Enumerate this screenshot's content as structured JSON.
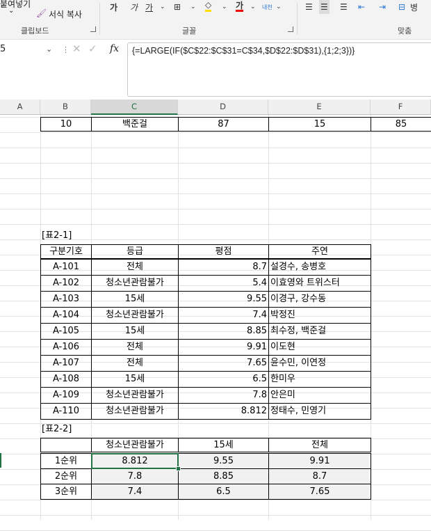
{
  "ribbon": {
    "paste_label": "붙여넣기",
    "format_painter_label": "서식 복사",
    "clipboard_group": "클립보드",
    "font_group": "글꼴",
    "align_group": "맞춤",
    "italic_label": "가",
    "underline_label": "가",
    "bold_label": "가",
    "font_color_label": "가",
    "phonetic_label": "내천",
    "merge_label": "병"
  },
  "formula_bar": {
    "name_box": "5",
    "fx_label": "fx",
    "formula": "{=LARGE(IF($C$22:$C$31=C$34,$D$22:$D$31),{1;2;3})}"
  },
  "columns": [
    "A",
    "B",
    "C",
    "D",
    "E",
    "F"
  ],
  "selected_column": "C",
  "top_row": {
    "b": "10",
    "c": "백준걸",
    "d": "87",
    "e": "15",
    "f": "85"
  },
  "table1": {
    "caption": "[표2-1]",
    "headers": [
      "구분기호",
      "등급",
      "평점",
      "주연"
    ],
    "rows": [
      [
        "A-101",
        "전체",
        "8.7",
        "설경수, 송병호"
      ],
      [
        "A-102",
        "청소년관람불가",
        "5.4",
        "이효영와 트위스터"
      ],
      [
        "A-103",
        "15세",
        "9.55",
        "이경구, 강수동"
      ],
      [
        "A-104",
        "청소년관람불가",
        "7.4",
        "박정진"
      ],
      [
        "A-105",
        "15세",
        "8.85",
        "최수정, 백준걸"
      ],
      [
        "A-106",
        "전체",
        "9.91",
        "이도현"
      ],
      [
        "A-107",
        "전체",
        "7.65",
        "윤수민, 이연정"
      ],
      [
        "A-108",
        "15세",
        "6.5",
        "한미우"
      ],
      [
        "A-109",
        "청소년관람불가",
        "7.8",
        "안은미"
      ],
      [
        "A-110",
        "청소년관람불가",
        "8.812",
        "정태수, 민영기"
      ]
    ]
  },
  "table2": {
    "caption": "[표2-2]",
    "headers": [
      "",
      "청소년관람불가",
      "15세",
      "전체"
    ],
    "rows": [
      [
        "1순위",
        "8.812",
        "9.55",
        "9.91"
      ],
      [
        "2순위",
        "7.8",
        "8.85",
        "8.7"
      ],
      [
        "3순위",
        "7.4",
        "6.5",
        "7.65"
      ]
    ]
  },
  "colors": {
    "accent": "#217346",
    "result_fill": "#f1f1f1"
  }
}
